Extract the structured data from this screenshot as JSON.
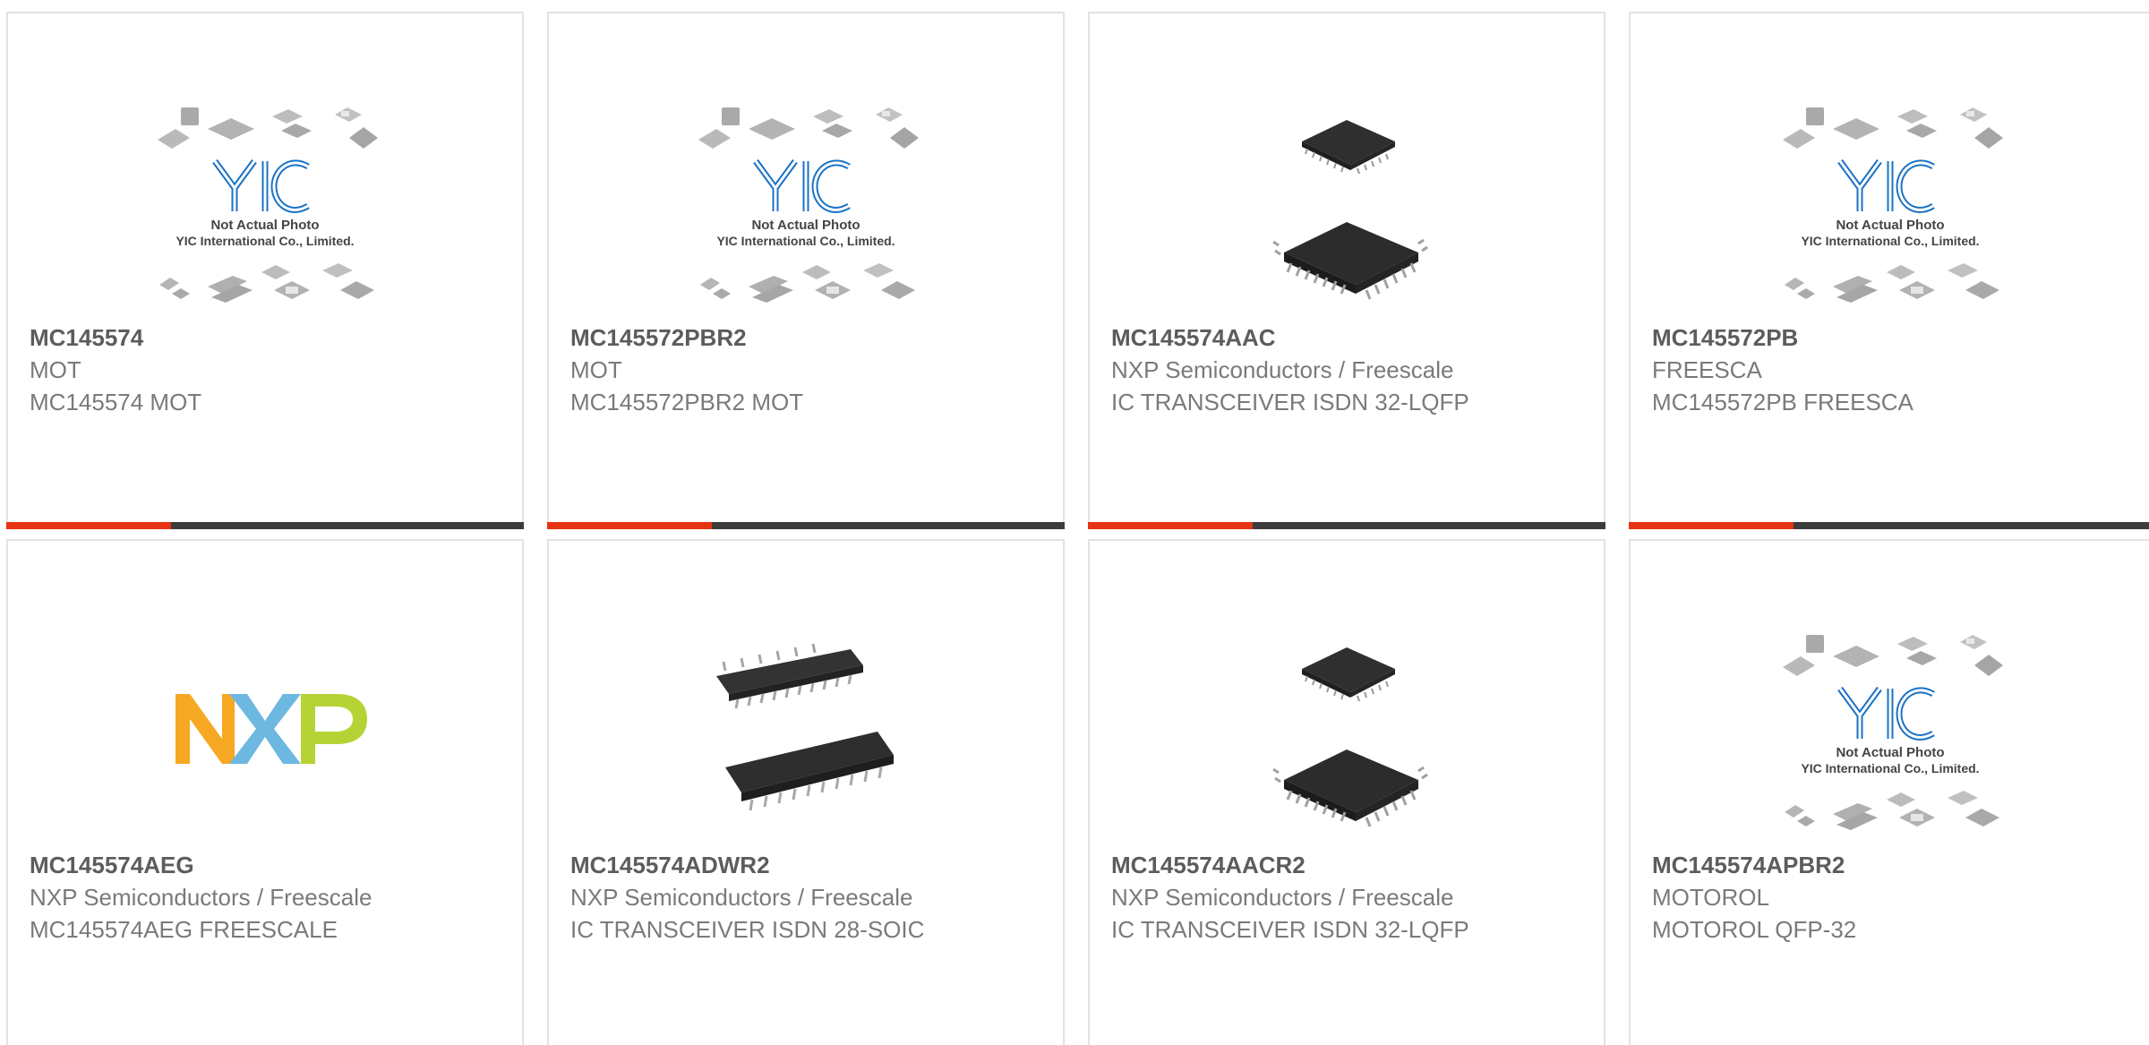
{
  "placeholder": {
    "line1": "Not Actual Photo",
    "line2": "YIC International Co., Limited.",
    "logo": "YIC"
  },
  "brand_logo": "NXP",
  "colors": {
    "accent": "#e63312",
    "bar": "#3c3c3c",
    "nxp_orange": "#f7a823",
    "nxp_blue": "#6db8e0",
    "nxp_green": "#b6d335",
    "yic_blue": "#1a73c4"
  },
  "products": [
    {
      "part": "MC145574",
      "manufacturer": "MOT",
      "description": "MC145574 MOT",
      "image": "not-actual-photo-placeholder"
    },
    {
      "part": "MC145572PBR2",
      "manufacturer": "MOT",
      "description": "MC145572PBR2 MOT",
      "image": "not-actual-photo-placeholder"
    },
    {
      "part": "MC145574AAC",
      "manufacturer": "NXP Semiconductors / Freescale",
      "description": "IC TRANSCEIVER ISDN 32-LQFP",
      "image": "qfp-chip-photo"
    },
    {
      "part": "MC145572PB",
      "manufacturer": "FREESCA",
      "description": "MC145572PB FREESCA",
      "image": "not-actual-photo-placeholder"
    },
    {
      "part": "MC145574AEG",
      "manufacturer": "NXP Semiconductors / Freescale",
      "description": "MC145574AEG FREESCALE",
      "image": "nxp-logo"
    },
    {
      "part": "MC145574ADWR2",
      "manufacturer": "NXP Semiconductors / Freescale",
      "description": "IC TRANSCEIVER ISDN 28-SOIC",
      "image": "soic-chip-photo"
    },
    {
      "part": "MC145574AACR2",
      "manufacturer": "NXP Semiconductors / Freescale",
      "description": "IC TRANSCEIVER ISDN 32-LQFP",
      "image": "qfp-chip-photo"
    },
    {
      "part": "MC145574APBR2",
      "manufacturer": "MOTOROL",
      "description": "MOTOROL QFP-32",
      "image": "not-actual-photo-placeholder"
    }
  ]
}
